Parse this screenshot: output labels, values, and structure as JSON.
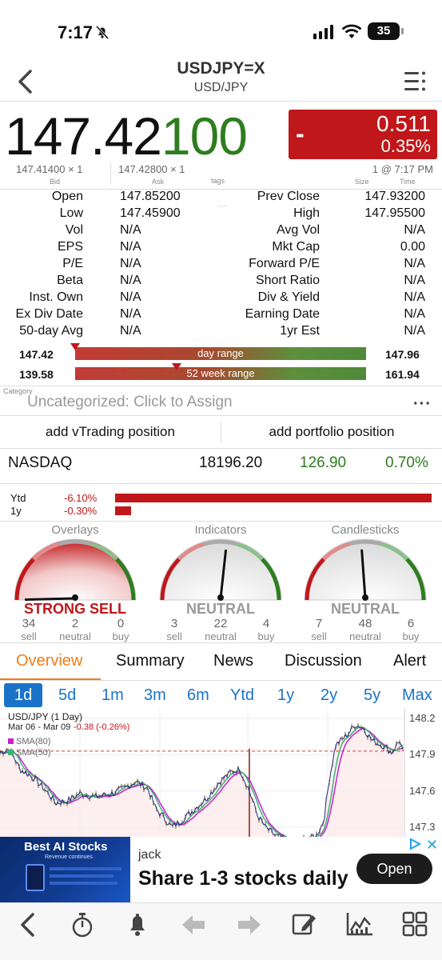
{
  "status": {
    "time": "7:17",
    "battery": "35"
  },
  "header": {
    "symbol": "USDJPY=X",
    "name": "USD/JPY"
  },
  "quote": {
    "price_main": "147.42",
    "price_tail": "100",
    "change": "-",
    "change_value": "0.511",
    "change_pct": "0.35%",
    "bid": "147.41400 × 1",
    "ask": "147.42800 × 1",
    "size_time": "1 @ 7:17 PM",
    "bid_label": "Bid",
    "ask_label": "Ask",
    "tags_label": "tags",
    "size_label": "Size",
    "time_label": "Time"
  },
  "stats": [
    {
      "l1": "Open",
      "v1": "147.85200",
      "l2": "Prev Close",
      "v2": "147.93200"
    },
    {
      "l1": "Low",
      "v1": "147.45900",
      "l2": "High",
      "v2": "147.95500"
    },
    {
      "l1": "Vol",
      "v1": "N/A",
      "l2": "Avg Vol",
      "v2": "N/A"
    },
    {
      "l1": "EPS",
      "v1": "N/A",
      "l2": "Mkt Cap",
      "v2": "0.00"
    },
    {
      "l1": "P/E",
      "v1": "N/A",
      "l2": "Forward P/E",
      "v2": "N/A"
    },
    {
      "l1": "Beta",
      "v1": "N/A",
      "l2": "Short Ratio",
      "v2": "N/A"
    },
    {
      "l1": "Inst. Own",
      "v1": "N/A",
      "l2": "Div & Yield",
      "v2": "N/A"
    },
    {
      "l1": "Ex Div Date",
      "v1": "N/A",
      "l2": "Earning Date",
      "v2": "N/A"
    },
    {
      "l1": "50-day Avg",
      "v1": "N/A",
      "l2": "1yr Est",
      "v2": "N/A"
    }
  ],
  "day_range": {
    "low": "147.42",
    "high": "147.96",
    "label": "day range",
    "position": 0.0
  },
  "week52_range": {
    "low": "139.58",
    "high": "161.94",
    "label": "52 week range",
    "position": 0.35
  },
  "category": {
    "label": "Category",
    "value": "Uncategorized: Click to Assign"
  },
  "actions": {
    "vtrading": "add vTrading position",
    "portfolio": "add portfolio position"
  },
  "index": {
    "name": "NASDAQ",
    "value": "18196.20",
    "change": "126.90",
    "pct": "0.70%"
  },
  "performance": [
    {
      "label": "Ytd",
      "value": "-6.10%",
      "fraction": 1.0
    },
    {
      "label": "1y",
      "value": "-0.30%",
      "fraction": 0.05
    }
  ],
  "gauges": [
    {
      "title": "Overlays",
      "result": "STRONG SELL",
      "sell": "34",
      "neutral": "2",
      "buy": "0",
      "result_color": "#c0171a"
    },
    {
      "title": "Indicators",
      "result": "NEUTRAL",
      "sell": "3",
      "neutral": "22",
      "buy": "4",
      "result_color": "#999999"
    },
    {
      "title": "Candlesticks",
      "result": "NEUTRAL",
      "sell": "7",
      "neutral": "48",
      "buy": "6",
      "result_color": "#999999"
    }
  ],
  "gauge_labels": {
    "sell": "sell",
    "neutral": "neutral",
    "buy": "buy"
  },
  "tabs": [
    "Overview",
    "Summary",
    "News",
    "Discussion",
    "Alert"
  ],
  "periods": [
    "1d",
    "5d",
    "1m",
    "3m",
    "6m",
    "Ytd",
    "1y",
    "2y",
    "5y",
    "Max"
  ],
  "chart": {
    "title": "USD/JPY (1 Day)",
    "range_text": "Mar 06 - Mar 09",
    "change_text": "-0.38 (-0.26%)",
    "sma1": "SMA(80)",
    "sma2": "SMA(50)",
    "y_ticks": [
      "148.2",
      "147.9",
      "147.6",
      "147.3"
    ],
    "prev_close": 147.93
  },
  "ad": {
    "left_title": "Best AI Stocks",
    "left_sub": "Revenue continues",
    "advertiser": "jack",
    "headline": "Share 1-3 stocks daily",
    "button": "Open"
  },
  "colors": {
    "up": "#2e7d1e",
    "down": "#c0171a",
    "accent": "#f07d1a",
    "link": "#1a73c9"
  }
}
